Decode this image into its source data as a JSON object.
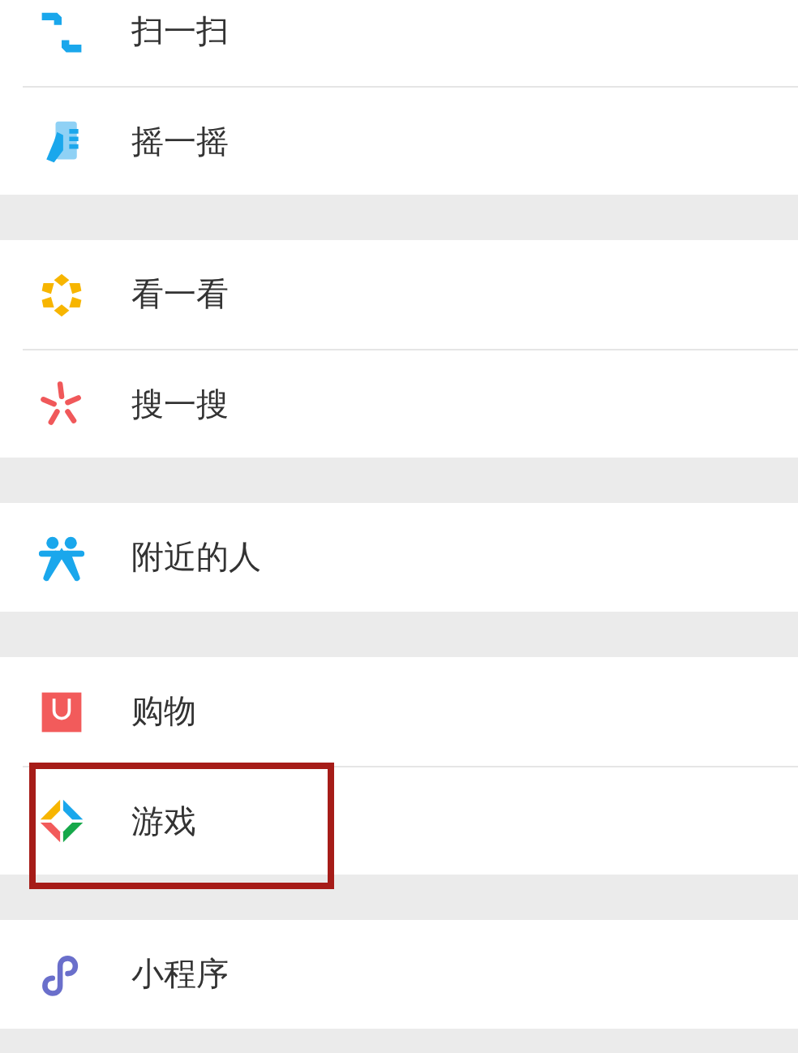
{
  "groups": [
    {
      "items": [
        {
          "kind": "scan",
          "label": "扫一扫",
          "highlighted": false
        },
        {
          "kind": "shake",
          "label": "摇一摇",
          "highlighted": false
        }
      ]
    },
    {
      "items": [
        {
          "kind": "look",
          "label": "看一看",
          "highlighted": false
        },
        {
          "kind": "search",
          "label": "搜一搜",
          "highlighted": false
        }
      ]
    },
    {
      "items": [
        {
          "kind": "nearby",
          "label": "附近的人",
          "highlighted": false
        }
      ]
    },
    {
      "items": [
        {
          "kind": "shop",
          "label": "购物",
          "highlighted": false
        },
        {
          "kind": "game",
          "label": "游戏",
          "highlighted": true
        }
      ]
    },
    {
      "items": [
        {
          "kind": "miniprogram",
          "label": "小程序",
          "highlighted": false
        }
      ]
    }
  ]
}
